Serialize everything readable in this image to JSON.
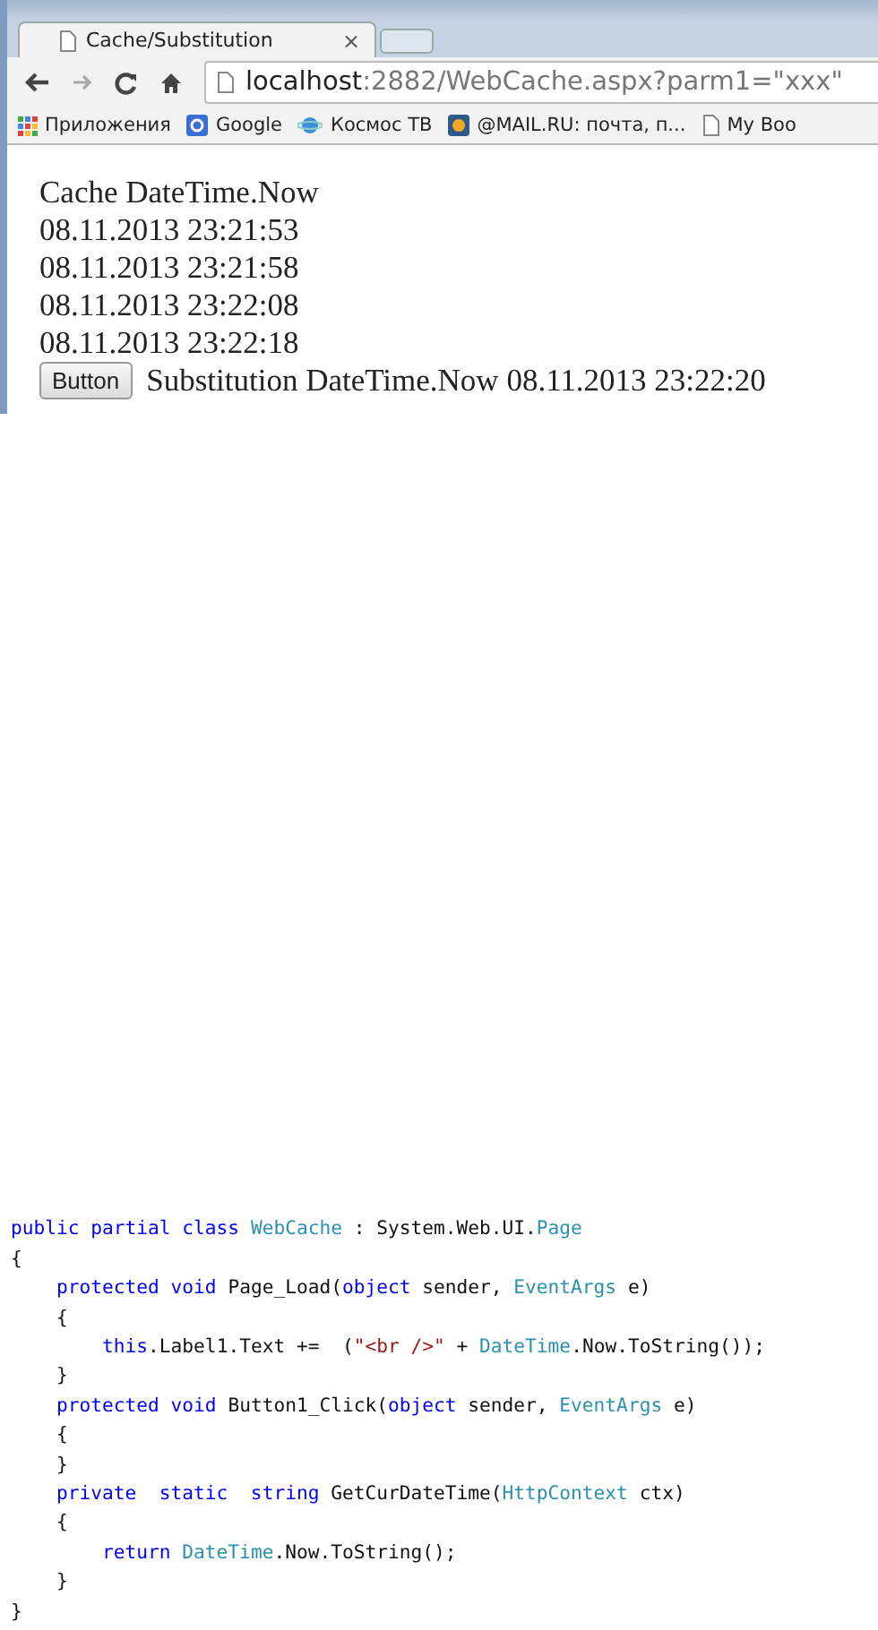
{
  "browser": {
    "tab": {
      "title": "Cache/Substitution",
      "close": "×"
    },
    "address": {
      "host": "localhost",
      "rest": ":2882/WebCache.aspx?parm1=\"xxx\""
    },
    "bookmarks": [
      {
        "kind": "apps",
        "label": "Приложения"
      },
      {
        "kind": "google",
        "label": "Google"
      },
      {
        "kind": "planet",
        "label": "Космос ТВ"
      },
      {
        "kind": "mail",
        "label": "@MAIL.RU: почта, п..."
      },
      {
        "kind": "page",
        "label": "My Boo"
      }
    ]
  },
  "page": {
    "heading": "Cache DateTime.Now",
    "times": [
      "08.11.2013 23:21:53",
      "08.11.2013 23:21:58",
      "08.11.2013 23:22:08",
      "08.11.2013 23:22:18"
    ],
    "button": "Button",
    "substitution": "Substitution DateTime.Now 08.11.2013 23:22:20"
  },
  "code": [
    [
      {
        "kind": "keyword",
        "text": "public partial class "
      },
      {
        "kind": "type",
        "text": "WebCache"
      },
      {
        "kind": "plain",
        "text": " : System.Web.UI."
      },
      {
        "kind": "type",
        "text": "Page"
      }
    ],
    [
      {
        "kind": "plain",
        "text": "{"
      }
    ],
    [
      {
        "kind": "keyword",
        "text": "    protected void "
      },
      {
        "kind": "plain",
        "text": "Page_Load("
      },
      {
        "kind": "keyword",
        "text": "object"
      },
      {
        "kind": "plain",
        "text": " sender, "
      },
      {
        "kind": "type",
        "text": "EventArgs"
      },
      {
        "kind": "plain",
        "text": " e)"
      }
    ],
    [
      {
        "kind": "plain",
        "text": "    {"
      }
    ],
    [
      {
        "kind": "keyword",
        "text": "        this"
      },
      {
        "kind": "plain",
        "text": ".Label1.Text +=  ("
      },
      {
        "kind": "string",
        "text": "\"<br />\""
      },
      {
        "kind": "plain",
        "text": " + "
      },
      {
        "kind": "type",
        "text": "DateTime"
      },
      {
        "kind": "plain",
        "text": ".Now.ToString());"
      }
    ],
    [
      {
        "kind": "plain",
        "text": "    }"
      }
    ],
    [
      {
        "kind": "keyword",
        "text": "    protected void "
      },
      {
        "kind": "plain",
        "text": "Button1_Click("
      },
      {
        "kind": "keyword",
        "text": "object"
      },
      {
        "kind": "plain",
        "text": " sender, "
      },
      {
        "kind": "type",
        "text": "EventArgs"
      },
      {
        "kind": "plain",
        "text": " e)"
      }
    ],
    [
      {
        "kind": "plain",
        "text": "    {"
      }
    ],
    [
      {
        "kind": "plain",
        "text": "    }"
      }
    ],
    [
      {
        "kind": "keyword",
        "text": "    private  static  string "
      },
      {
        "kind": "plain",
        "text": "GetCurDateTime("
      },
      {
        "kind": "type",
        "text": "HttpContext"
      },
      {
        "kind": "plain",
        "text": " ctx)"
      }
    ],
    [
      {
        "kind": "plain",
        "text": "    {"
      }
    ],
    [
      {
        "kind": "keyword",
        "text": "        return "
      },
      {
        "kind": "type",
        "text": "DateTime"
      },
      {
        "kind": "plain",
        "text": ".Now.ToString();"
      }
    ],
    [
      {
        "kind": "plain",
        "text": "    }"
      }
    ],
    [
      {
        "kind": "plain",
        "text": "}"
      }
    ]
  ]
}
